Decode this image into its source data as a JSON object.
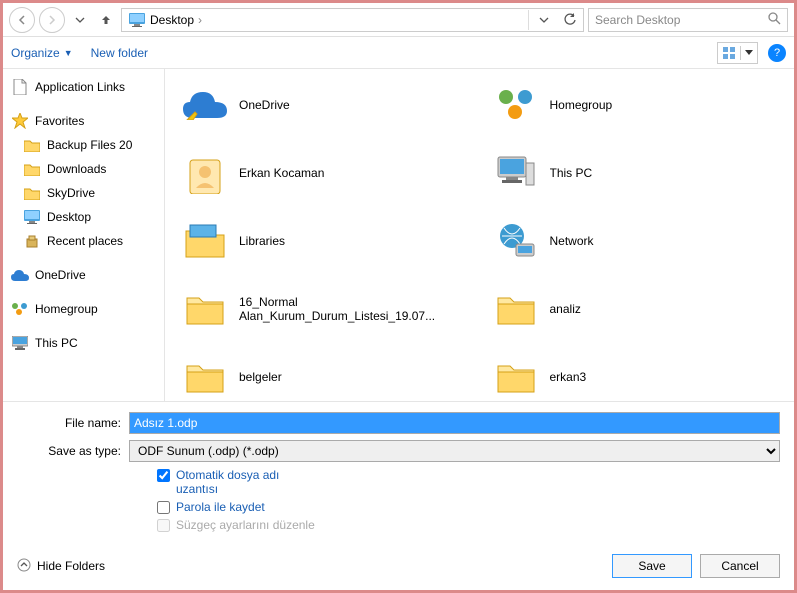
{
  "nav": {
    "location_icon": "desktop",
    "location_label": "Desktop",
    "search_placeholder": "Search Desktop"
  },
  "toolbar": {
    "organize": "Organize",
    "new_folder": "New folder"
  },
  "sidebar": {
    "app_links": "Application Links",
    "favorites": "Favorites",
    "fav_items": [
      {
        "label": "Backup Files 20",
        "icon": "folder"
      },
      {
        "label": "Downloads",
        "icon": "folder"
      },
      {
        "label": "SkyDrive",
        "icon": "folder"
      },
      {
        "label": "Desktop",
        "icon": "desktop"
      },
      {
        "label": "Recent places",
        "icon": "recent"
      }
    ],
    "onedrive": "OneDrive",
    "homegroup": "Homegroup",
    "thispc": "This PC"
  },
  "items": [
    {
      "label": "OneDrive",
      "icon": "onedrive"
    },
    {
      "label": "Homegroup",
      "icon": "homegroup"
    },
    {
      "label": "Erkan Kocaman",
      "icon": "user"
    },
    {
      "label": "This PC",
      "icon": "pc"
    },
    {
      "label": "Libraries",
      "icon": "libraries"
    },
    {
      "label": "Network",
      "icon": "network"
    },
    {
      "label": "16_Normal Alan_Kurum_Durum_Listesi_19.07...",
      "icon": "folder"
    },
    {
      "label": "analiz",
      "icon": "folder"
    },
    {
      "label": "belgeler",
      "icon": "folder"
    },
    {
      "label": "erkan3",
      "icon": "folder"
    }
  ],
  "fields": {
    "filename_label": "File name:",
    "filename_value": "Adsız 1.odp",
    "type_label": "Save as type:",
    "type_value": "ODF Sunum (.odp) (*.odp)"
  },
  "options": {
    "auto_ext": "Otomatik dosya adı uzantısı",
    "auto_ext_checked": true,
    "password": "Parola ile kaydet",
    "password_checked": false,
    "filter": "Süzgeç ayarlarını düzenle"
  },
  "footer": {
    "hide_folders": "Hide Folders",
    "save": "Save",
    "cancel": "Cancel"
  }
}
